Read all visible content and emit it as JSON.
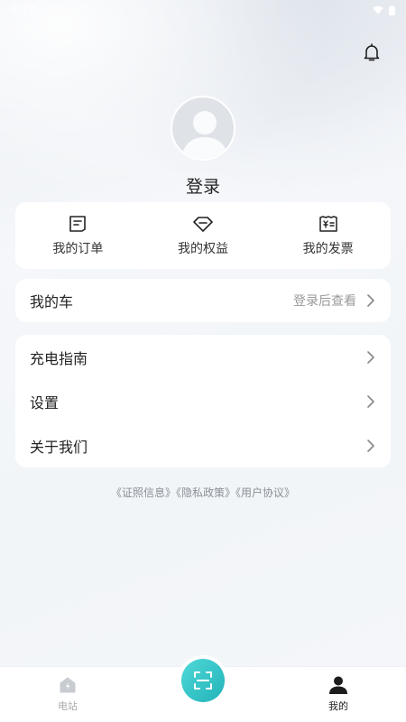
{
  "status_bar": {
    "time": "8:57"
  },
  "profile": {
    "login_label": "登录"
  },
  "quick_actions": [
    {
      "label": "我的订单",
      "icon": "order-icon"
    },
    {
      "label": "我的权益",
      "icon": "benefit-icon"
    },
    {
      "label": "我的发票",
      "icon": "invoice-icon"
    }
  ],
  "car": {
    "label": "我的车",
    "hint": "登录后查看"
  },
  "menu": [
    {
      "label": "充电指南"
    },
    {
      "label": "设置"
    },
    {
      "label": "关于我们"
    }
  ],
  "footer_links": [
    "《证照信息》",
    "《隐私政策》",
    "《用户协议》"
  ],
  "tabbar": {
    "home_label": "电站",
    "me_label": "我的"
  },
  "colors": {
    "accent": "#2ec4c6",
    "hint": "#999999"
  }
}
